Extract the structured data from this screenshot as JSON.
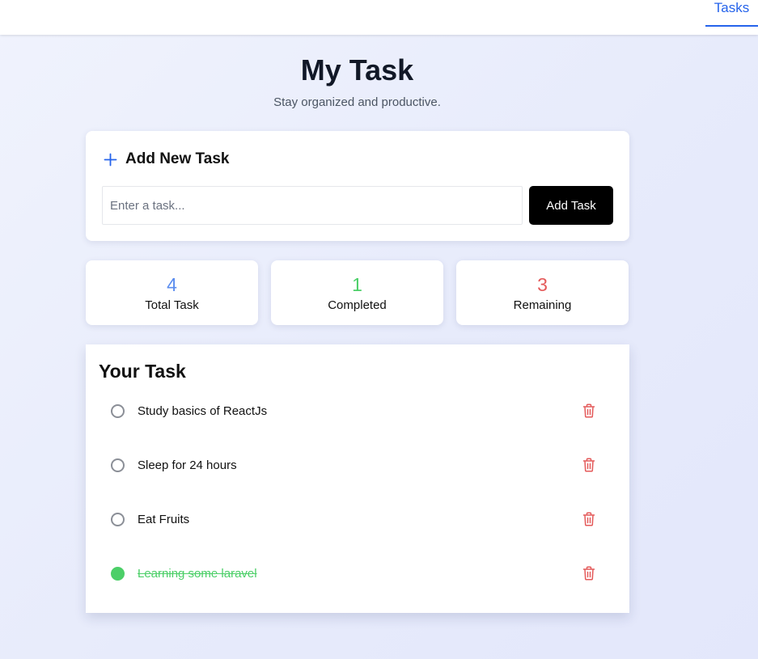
{
  "nav": {
    "tab_label": "Tasks"
  },
  "header": {
    "title": "My Task",
    "subtitle": "Stay organized and productive."
  },
  "add_task": {
    "title": "Add New Task",
    "input_value": "",
    "input_placeholder": "Enter a task...",
    "button_label": "Add Task"
  },
  "stats": {
    "total": {
      "value": "4",
      "label": "Total Task",
      "color": "#5b8def"
    },
    "completed": {
      "value": "1",
      "label": "Completed",
      "color": "#4ccf68"
    },
    "remaining": {
      "value": "3",
      "label": "Remaining",
      "color": "#e45a5a"
    }
  },
  "task_list": {
    "title": "Your Task",
    "items": [
      {
        "text": "Study basics of ReactJs",
        "completed": false
      },
      {
        "text": "Sleep for 24 hours",
        "completed": false
      },
      {
        "text": "Eat Fruits",
        "completed": false
      },
      {
        "text": "Learning some laravel",
        "completed": true
      }
    ]
  },
  "icons": {
    "add": "plus-icon",
    "delete": "trash-icon",
    "unchecked": "circle-icon",
    "checked": "filled-circle-icon"
  },
  "colors": {
    "accent": "#2563eb",
    "delete_red": "#e45a5a",
    "done_green": "#4ccf68"
  }
}
